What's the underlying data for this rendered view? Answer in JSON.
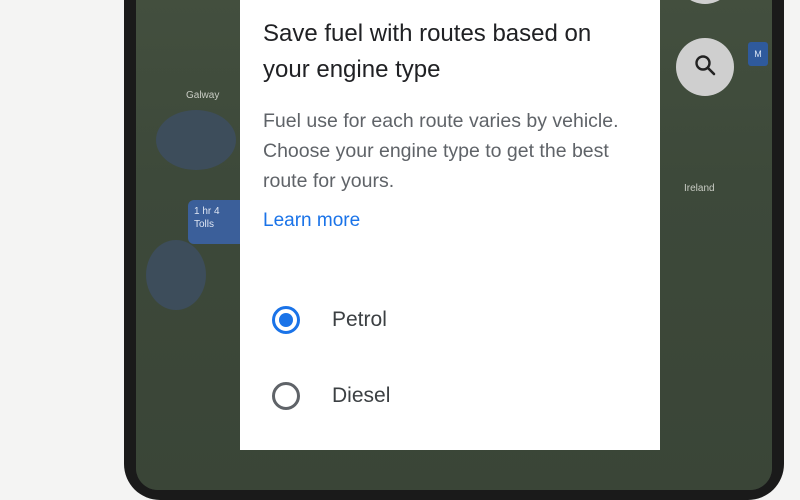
{
  "dialog": {
    "title": "Save fuel with routes based on your engine type",
    "description": "Fuel use for each route varies by vehicle. Choose your engine type to get the best route for yours.",
    "learn_more": "Learn more",
    "options": [
      {
        "label": "Petrol",
        "selected": true
      },
      {
        "label": "Diesel",
        "selected": false
      }
    ]
  },
  "map": {
    "labels": {
      "galway": "Galway",
      "ireland": "Ireland"
    },
    "route_chip": {
      "line1": "1 hr 4",
      "line2": "Tolls"
    },
    "blue_tag": "M"
  },
  "colors": {
    "accent": "#1a73e8",
    "title_text": "#202124",
    "body_text": "#5f6368"
  },
  "icons": {
    "search": "search-icon"
  }
}
